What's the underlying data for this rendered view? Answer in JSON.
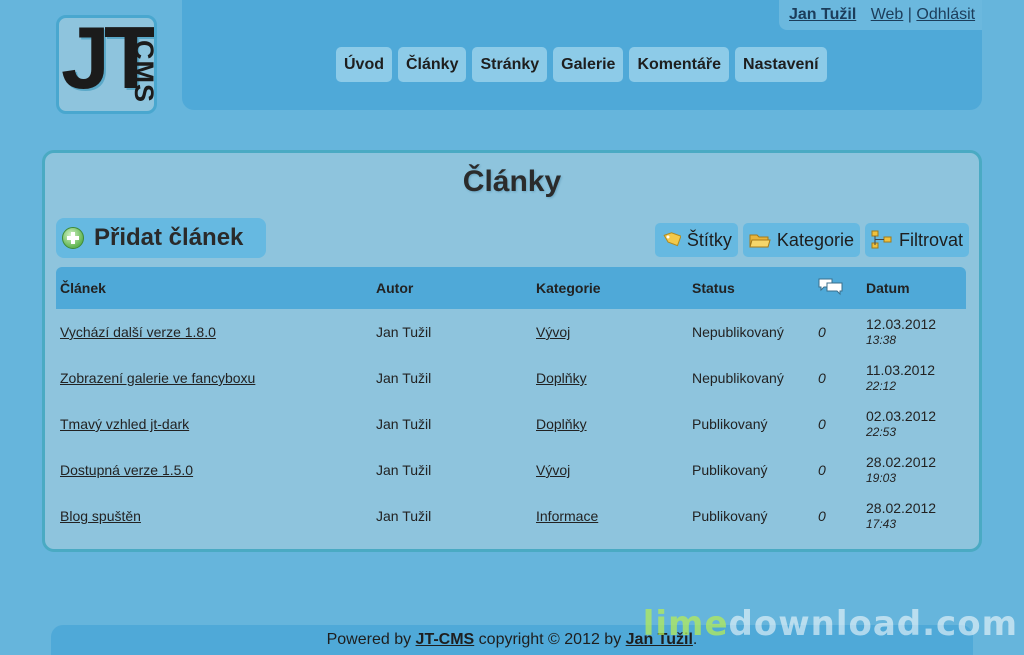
{
  "logo": {
    "jt": "JT",
    "cms": "CMS"
  },
  "userbar": {
    "user": "Jan Tužil",
    "web": "Web",
    "sep": "|",
    "logout": "Odhlásit"
  },
  "nav": [
    {
      "label": "Úvod"
    },
    {
      "label": "Články"
    },
    {
      "label": "Stránky"
    },
    {
      "label": "Galerie"
    },
    {
      "label": "Komentáře"
    },
    {
      "label": "Nastavení"
    }
  ],
  "page": {
    "title": "Články",
    "add_label": "Přidat článek",
    "tools": {
      "tags": "Štítky",
      "categories": "Kategorie",
      "filter": "Filtrovat"
    }
  },
  "table": {
    "headers": {
      "article": "Článek",
      "author": "Autor",
      "category": "Kategorie",
      "status": "Status",
      "date": "Datum"
    },
    "rows": [
      {
        "title": "Vychází další verze 1.8.0",
        "author": "Jan Tužil",
        "category": "Vývoj",
        "status": "Nepublikovaný",
        "comments": "0",
        "date": "12.03.2012",
        "time": "13:38"
      },
      {
        "title": "Zobrazení galerie ve fancyboxu",
        "author": "Jan Tužil",
        "category": "Doplňky",
        "status": "Nepublikovaný",
        "comments": "0",
        "date": "11.03.2012",
        "time": "22:12"
      },
      {
        "title": "Tmavý vzhled jt-dark",
        "author": "Jan Tužil",
        "category": "Doplňky",
        "status": "Publikovaný",
        "comments": "0",
        "date": "02.03.2012",
        "time": "22:53"
      },
      {
        "title": "Dostupná verze 1.5.0",
        "author": "Jan Tužil",
        "category": "Vývoj",
        "status": "Publikovaný",
        "comments": "0",
        "date": "28.02.2012",
        "time": "19:03"
      },
      {
        "title": "Blog spuštěn",
        "author": "Jan Tužil",
        "category": "Informace",
        "status": "Publikovaný",
        "comments": "0",
        "date": "28.02.2012",
        "time": "17:43"
      }
    ]
  },
  "footer": {
    "prefix": "Powered by ",
    "product": "JT-CMS",
    "middle": " copyright © 2012 by ",
    "author": "Jan Tužil",
    "suffix": "."
  },
  "watermark": {
    "lime": "lime",
    "rest": "download.com"
  },
  "colors": {
    "unpublished": "#e0161e",
    "published": "#0f8a1c",
    "header": "#4fa9d8",
    "panel": "#8ec4dd"
  }
}
